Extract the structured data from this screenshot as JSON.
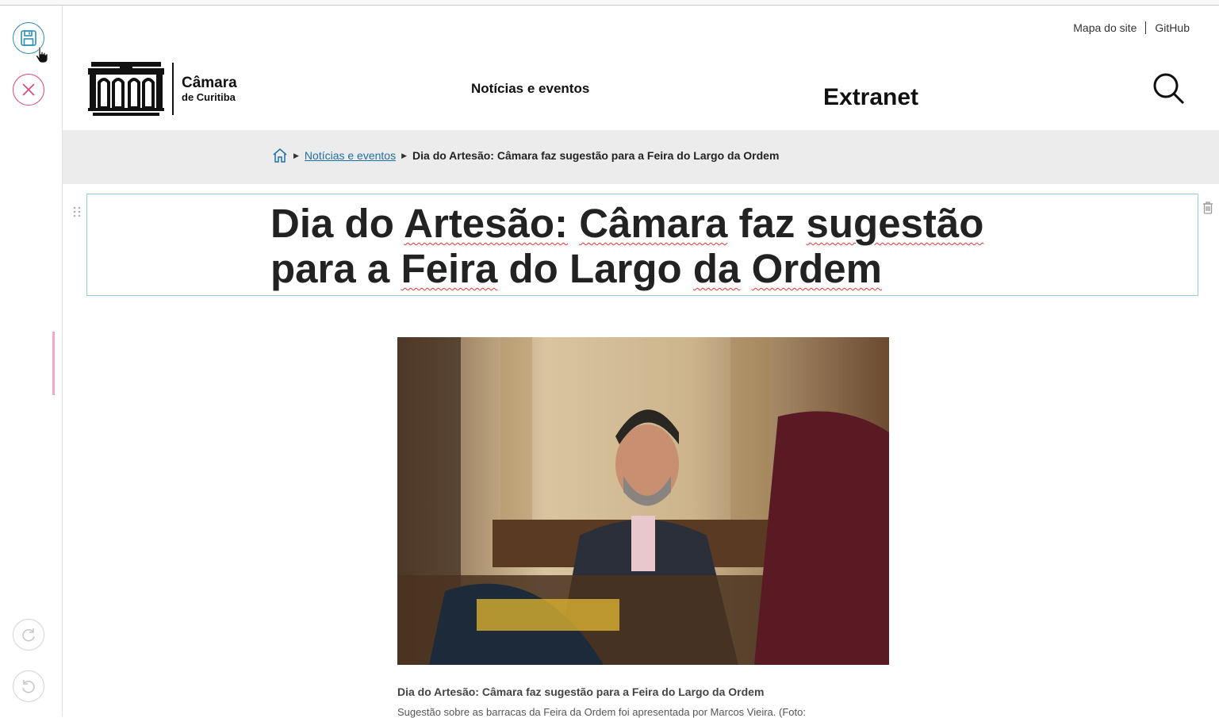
{
  "toolbar": {
    "save": "save-icon",
    "cancel": "close-icon",
    "redo": "redo-icon",
    "undo": "undo-icon"
  },
  "header": {
    "top_links": [
      "Mapa do site",
      "GitHub"
    ],
    "logo_line1": "Câmara",
    "logo_line2": "de Curitiba",
    "nav_news": "Notícias e eventos",
    "nav_extranet": "Extranet"
  },
  "breadcrumb": {
    "link": "Notícias e eventos",
    "current": "Dia do Artesão: Câmara faz sugestão para a Feira do Largo da Ordem"
  },
  "article": {
    "title_words": [
      "Dia",
      "do",
      "Artesão:",
      "Câmara",
      "faz",
      "sugestão",
      "para",
      "a",
      "Feira",
      "do",
      "Largo",
      "da",
      "Ordem"
    ],
    "caption_title": "Dia do Artesão: Câmara faz sugestão para a Feira do Largo da Ordem",
    "caption_text": "Sugestão sobre as barracas da Feira da Ordem foi apresentada por Marcos Vieira. (Foto:"
  },
  "colors": {
    "accent_blue": "#2c8fb3",
    "cancel_pink": "#e4427a",
    "band_gray": "#ececec",
    "link_blue": "#1f6fa5"
  }
}
